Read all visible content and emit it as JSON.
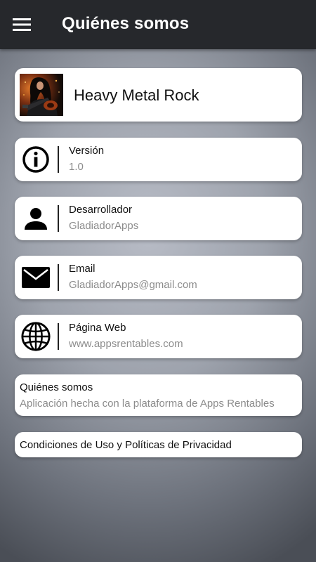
{
  "appbar": {
    "title": "Quiénes somos",
    "menu_icon": "hamburger-menu-icon"
  },
  "app": {
    "name": "Heavy Metal Rock",
    "image": "guitarist-photo"
  },
  "items": [
    {
      "icon": "info-icon",
      "label": "Versión",
      "value": "1.0"
    },
    {
      "icon": "person-icon",
      "label": "Desarrollador",
      "value": "GladiadorApps"
    },
    {
      "icon": "email-icon",
      "label": "Email",
      "value": "GladiadorApps@gmail.com"
    },
    {
      "icon": "globe-icon",
      "label": "Página Web",
      "value": "www.appsrentables.com"
    }
  ],
  "about": {
    "label": "Quiénes somos",
    "value": "Aplicación hecha con la plataforma de Apps Rentables"
  },
  "terms": {
    "label": "Condiciones de Uso y Políticas de Privacidad"
  },
  "colors": {
    "appbar": "#26282c",
    "card": "#ffffff",
    "secondary_text": "#8c8c8c"
  }
}
